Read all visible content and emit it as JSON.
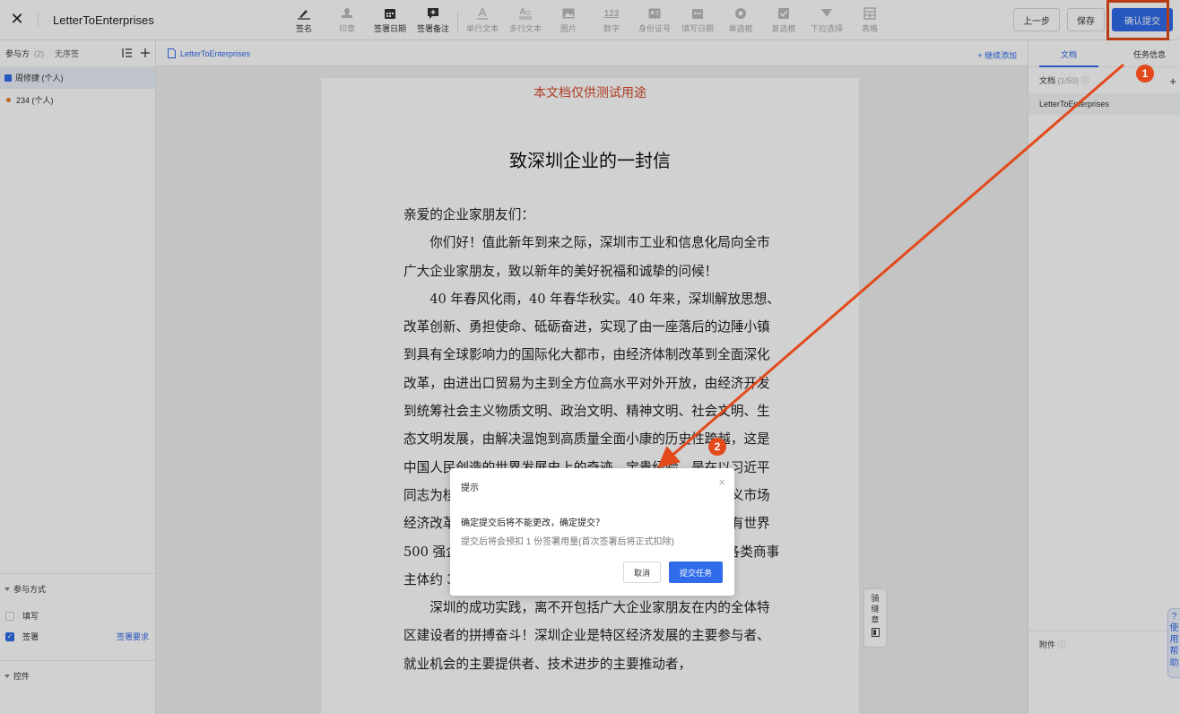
{
  "header": {
    "close_glyph": "✕",
    "doc_title": "LetterToEnterprises",
    "tools": [
      {
        "label": "签名",
        "icon": "pen-sign-icon",
        "disabled": false
      },
      {
        "label": "印章",
        "icon": "stamp-icon",
        "disabled": true
      },
      {
        "label": "签署日期",
        "icon": "calendar-icon",
        "disabled": false
      },
      {
        "label": "签署备注",
        "icon": "note-plus-icon",
        "disabled": false
      },
      {
        "label": "单行文本",
        "icon": "text-line-icon",
        "disabled": true
      },
      {
        "label": "多行文本",
        "icon": "text-multiline-icon",
        "disabled": true
      },
      {
        "label": "图片",
        "icon": "image-icon",
        "disabled": true
      },
      {
        "label": "数字",
        "icon": "number-icon",
        "disabled": true
      },
      {
        "label": "身份证号",
        "icon": "id-card-icon",
        "disabled": true
      },
      {
        "label": "填写日期",
        "icon": "calendar-fill-icon",
        "disabled": true
      },
      {
        "label": "单选框",
        "icon": "radio-icon",
        "disabled": true
      },
      {
        "label": "复选框",
        "icon": "checkbox-icon",
        "disabled": true
      },
      {
        "label": "下拉选择",
        "icon": "dropdown-icon",
        "disabled": true
      },
      {
        "label": "表格",
        "icon": "table-icon",
        "disabled": true
      }
    ],
    "number_glyph": "123",
    "prev_label": "上一步",
    "save_label": "保存",
    "submit_label": "确认提交"
  },
  "left_panel": {
    "participants_label": "参与方",
    "participants_count": "(2)",
    "order_label": "无序签",
    "parties": [
      {
        "name": "周修捷 (个人)",
        "active": true
      },
      {
        "name": "234 (个人)",
        "active": false
      }
    ],
    "mode_section": "参与方式",
    "fill_label": "填写",
    "sign_label": "签署",
    "sign_requirements": "签署要求",
    "controls_section": "控件"
  },
  "center": {
    "doc_tab": "LetterToEnterprises",
    "add_more": "+ 继续添加",
    "watermark": "本文档仅供测试用途",
    "letter_title": "致深圳企业的一封信",
    "paragraphs": [
      {
        "text": "亲爱的企业家朋友们：",
        "indent": false
      },
      {
        "text": "你们好！值此新年到来之际，深圳市工业和信息化局向全市广大企业家朋友，致以新年的美好祝福和诚挚的问候！",
        "indent": true
      },
      {
        "text": "40 年春风化雨，40 年春华秋实。40 年来，深圳解放思想、改革创新、勇担使命、砥砺奋进，实现了由一座落后的边陲小镇到具有全球影响力的国际化大都市，由经济体制改革到全面深化改革，由进出口贸易为主到全方位高水平对外开放，由经济开发到统筹社会主义物质文明、政治文明、精神文明、社会文明、生态文明发展，由解决温饱到高质量全面小康的历史性跨越，这是中国人民创造的世界发展史上的奇迹。宝贵经验，是在以习近平同志为核心的党中央和总书记指引的方向下，坚持社会主义市场经济改革方向，逐步建立起发展市场体系。目前，深圳拥有世界 500 强企业 8 家，国家级高新技术企业超过 1.7 万家，各类商事主体约 350 万户。",
        "indent": true
      },
      {
        "text": "深圳的成功实践，离不开包括广大企业家朋友在内的全体特区建设者的拼搏奋斗！深圳企业是特区经济发展的主要参与者、就业机会的主要提供者、技术进步的主要推动者，",
        "indent": true
      }
    ],
    "seam_label": "骑缝章"
  },
  "right_panel": {
    "tab_docs": "文档",
    "tab_task": "任务信息",
    "docs_label": "文档",
    "docs_count": "(1/50)",
    "doc_item": "LetterToEnterprises",
    "attachments_label": "附件",
    "help_text": "?使用帮助"
  },
  "modal": {
    "title": "提示",
    "message": "确定提交后将不能更改，确定提交？",
    "sub_message": "提交后将会预扣 1 份签署用量(首次签署后将正式扣除)",
    "cancel_label": "取消",
    "submit_label": "提交任务"
  },
  "annotations": {
    "badge_1": "1",
    "badge_2": "2",
    "color": "#e24a1b"
  },
  "colors": {
    "accent": "#2f6bea",
    "watermark": "#d44a2a"
  }
}
